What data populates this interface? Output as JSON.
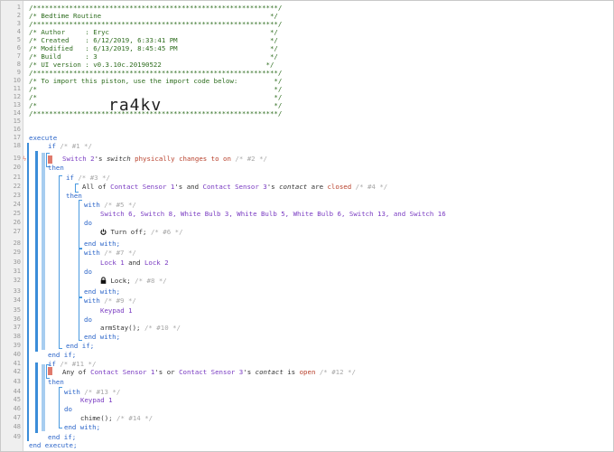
{
  "header": {
    "stars": "/*************************************************************/",
    "title": "/* Bedtime Routine                                          */",
    "author": "/* Author     : Eryc                                        */",
    "created": "/* Created    : 6/12/2019, 6:33:41 PM                       */",
    "modified": "/* Modified   : 6/13/2019, 8:45:45 PM                       */",
    "build": "/* Build      : 3                                           */",
    "ui_version": "/* UI version : v0.3.10c.20190522                          */",
    "import_note": "/* To import this piston, use the import code below:         */",
    "blank": "/*                                                           */",
    "import_code": "ra4kv"
  },
  "code": {
    "execute": "execute",
    "if1": "if",
    "if1_c": " /* #1 */",
    "l18_dev": "Switch 2",
    "l18_a": "'s ",
    "l18_attr": "switch",
    "l18_b": " ",
    "l18_op": "physically changes to",
    "l18_c": " ",
    "l18_val": "on",
    "l18_cmt": " /* #2 */",
    "then1": "then",
    "if3": "if",
    "if3_c": " /* #3 */",
    "l21_a": "All of ",
    "l21_d1": "Contact Sensor 1",
    "l21_b": "'s and ",
    "l21_d2": "Contact Sensor 3",
    "l21_c": "'s ",
    "l21_attr": "contact",
    "l21_e": " are ",
    "l21_val": "closed",
    "l21_cmt": " /* #4 */",
    "then3": "then",
    "with5": "with",
    "with5_c": " /* #5 */",
    "l24_devs": "Switch 6, Switch 8, White Bulb 3, White Bulb 5, White Bulb 6, Switch 13, and Switch 16",
    "do1": "do",
    "turnoff": "Turn off;",
    "turnoff_c": " /* #6 */",
    "endwith1": "end with;",
    "with7": "with",
    "with7_c": " /* #7 */",
    "l29_d1": "Lock 1",
    "l29_and": " and ",
    "l29_d2": "Lock 2",
    "do2": "do",
    "lock": "Lock;",
    "lock_c": " /* #8 */",
    "endwith2": "end with;",
    "with9": "with",
    "with9_c": " /* #9 */",
    "l34_dev": "Keypad 1",
    "do3": "do",
    "armstay": "armStay();",
    "armstay_c": " /* #10 */",
    "endwith3": "end with;",
    "endif3": "end if;",
    "endif1": "end if;",
    "if11": "if",
    "if11_c": " /* #11 */",
    "l41_a": "Any of ",
    "l41_d1": "Contact Sensor 1",
    "l41_b": "'s or ",
    "l41_d2": "Contact Sensor 3",
    "l41_c": "'s ",
    "l41_attr": "contact",
    "l41_e": " is ",
    "l41_val": "open",
    "l41_cmt": " /* #12 */",
    "then11": "then",
    "with13": "with",
    "with13_c": " /* #13 */",
    "l44_dev": "Keypad 1",
    "do4": "do",
    "chime": "chime();",
    "chime_c": " /* #14 */",
    "endwith4": "end with;",
    "endif11": "end if;",
    "endexec": "end execute;"
  },
  "line_numbers": [
    "1",
    "2",
    "3",
    "4",
    "5",
    "6",
    "7",
    "8",
    "9",
    "10",
    "11",
    "12",
    "13",
    "14",
    "15",
    "16",
    "17",
    "18",
    "19",
    "20",
    "21",
    "22",
    "23",
    "24",
    "25",
    "26",
    "27",
    "28",
    "29",
    "30",
    "31",
    "32",
    "33",
    "34",
    "35",
    "36",
    "37",
    "38",
    "39",
    "40",
    "41",
    "42",
    "43",
    "44",
    "45",
    "46",
    "47",
    "48",
    "49"
  ]
}
